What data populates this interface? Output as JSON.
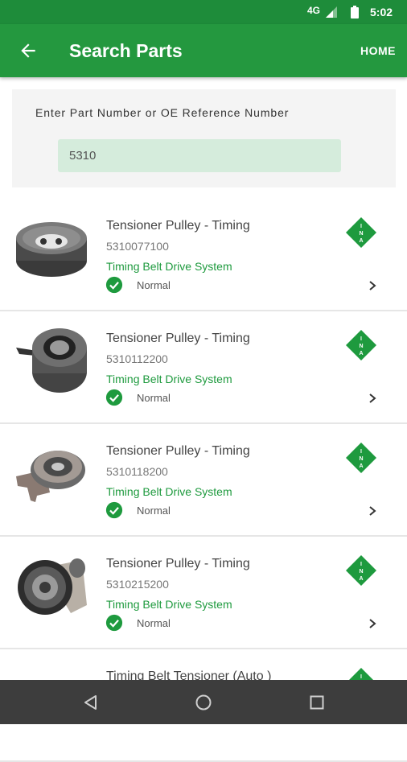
{
  "status_bar": {
    "network": "4G",
    "time": "5:02"
  },
  "app_bar": {
    "title": "Search Parts",
    "home_label": "HOME"
  },
  "search": {
    "label": "Enter Part Number or OE Reference Number",
    "value": "5310"
  },
  "results": [
    {
      "name": "Tensioner Pulley - Timing",
      "part_number": "5310077100",
      "system": "Timing Belt Drive System",
      "status": "Normal"
    },
    {
      "name": "Tensioner Pulley - Timing",
      "part_number": "5310112200",
      "system": "Timing Belt Drive System",
      "status": "Normal"
    },
    {
      "name": "Tensioner Pulley - Timing",
      "part_number": "5310118200",
      "system": "Timing Belt Drive System",
      "status": "Normal"
    },
    {
      "name": "Tensioner Pulley - Timing",
      "part_number": "5310215200",
      "system": "Timing Belt Drive System",
      "status": "Normal"
    },
    {
      "name": "Timing Belt Tensioner (Auto )",
      "part_number": "",
      "system": "",
      "status": ""
    }
  ],
  "brand": {
    "logo_text": "INA",
    "accent_color": "#1e9a3e"
  },
  "icons": {
    "back": "arrow-back-icon",
    "status_ok": "check-circle-icon",
    "chevron": "chevron-right-icon",
    "nav_back": "triangle-back-icon",
    "nav_home": "circle-home-icon",
    "nav_recents": "square-recents-icon"
  }
}
